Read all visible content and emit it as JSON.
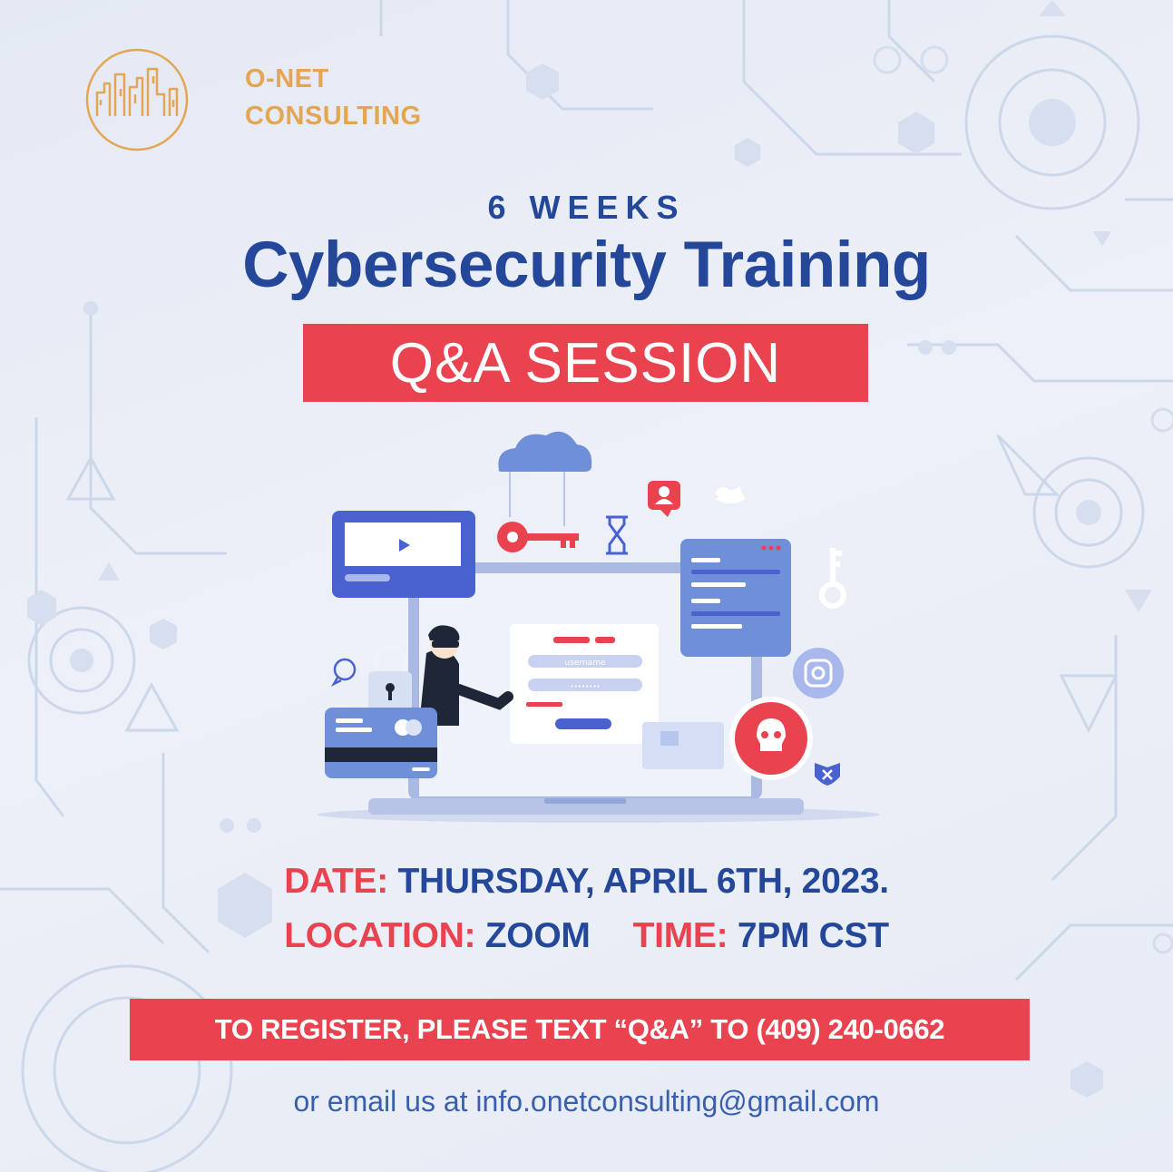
{
  "brand": {
    "name_line1": "O-NET",
    "name_line2": "CONSULTING"
  },
  "headline": {
    "duration": "6 WEEKS",
    "title": "Cybersecurity Training",
    "session": "Q&A SESSION"
  },
  "illustration": {
    "login_username_placeholder": "username",
    "login_password_mask": "••••••••"
  },
  "details": {
    "date_label": "DATE:",
    "date_value": "THURSDAY, APRIL 6TH, 2023.",
    "location_label": "LOCATION:",
    "location_value": "ZOOM",
    "time_label": "TIME:",
    "time_value": "7PM CST"
  },
  "register": {
    "text": "TO REGISTER, PLEASE TEXT “Q&A” TO (409) 240-0662"
  },
  "contact": {
    "email_line": "or email us  at info.onetconsulting@gmail.com"
  },
  "colors": {
    "navy": "#24479a",
    "red": "#e8434f",
    "gold": "#e5a654",
    "background": "#e8ecf6"
  }
}
